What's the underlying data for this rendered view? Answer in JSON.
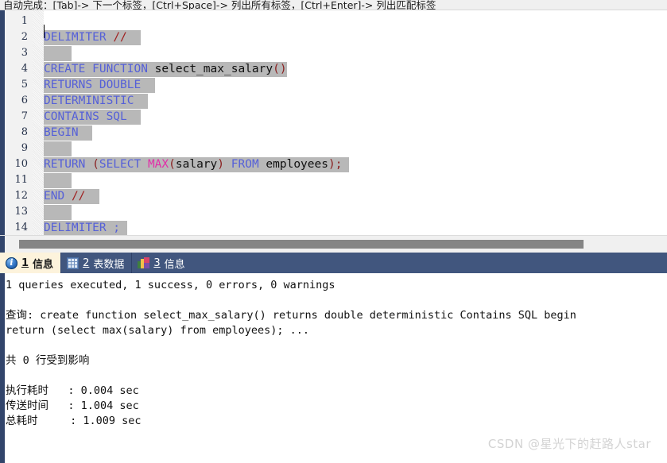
{
  "hint_bar": {
    "text": "自动完成：[Tab]-> 下一个标签，[Ctrl+Space]-> 列出所有标签，[Ctrl+Enter]-> 列出匹配标签"
  },
  "editor": {
    "line_numbers": [
      "1",
      "2",
      "3",
      "4",
      "5",
      "6",
      "7",
      "8",
      "9",
      "10",
      "11",
      "12",
      "13",
      "14"
    ],
    "fold_marker": "collapse-fold-marker",
    "lines": [
      {
        "n": "1",
        "tokens": []
      },
      {
        "n": "2",
        "tokens": [
          {
            "t": "DELIMITER",
            "c": "kw"
          },
          {
            "t": " ",
            "c": "id"
          },
          {
            "t": "//",
            "c": "cm"
          },
          {
            "t": "  ",
            "c": "id"
          }
        ]
      },
      {
        "n": "3",
        "tokens": [
          {
            "t": "    ",
            "c": "id"
          }
        ]
      },
      {
        "n": "4",
        "tokens": [
          {
            "t": "CREATE FUNCTION",
            "c": "kw"
          },
          {
            "t": " select_max_salary",
            "c": "id"
          },
          {
            "t": "()",
            "c": "pn"
          }
        ]
      },
      {
        "n": "5",
        "tokens": [
          {
            "t": "RETURNS DOUBLE",
            "c": "kw"
          },
          {
            "t": "  ",
            "c": "id"
          }
        ]
      },
      {
        "n": "6",
        "tokens": [
          {
            "t": "DETERMINISTIC",
            "c": "kw"
          },
          {
            "t": "  ",
            "c": "id"
          }
        ]
      },
      {
        "n": "7",
        "tokens": [
          {
            "t": "CONTAINS SQL",
            "c": "kw"
          },
          {
            "t": "  ",
            "c": "id"
          }
        ]
      },
      {
        "n": "8",
        "tokens": [
          {
            "t": "BEGIN",
            "c": "kw"
          },
          {
            "t": "  ",
            "c": "id"
          }
        ]
      },
      {
        "n": "9",
        "tokens": [
          {
            "t": "    ",
            "c": "id"
          }
        ]
      },
      {
        "n": "10",
        "tokens": [
          {
            "t": "RETURN ",
            "c": "kw"
          },
          {
            "t": "(",
            "c": "pn"
          },
          {
            "t": "SELECT ",
            "c": "kw"
          },
          {
            "t": "MAX",
            "c": "fn"
          },
          {
            "t": "(",
            "c": "pn"
          },
          {
            "t": "salary",
            "c": "id"
          },
          {
            "t": ")",
            "c": "pn"
          },
          {
            "t": " ",
            "c": "id"
          },
          {
            "t": "FROM",
            "c": "kw"
          },
          {
            "t": " employees",
            "c": "id"
          },
          {
            "t": ");",
            "c": "pn"
          },
          {
            "t": " ",
            "c": "id"
          }
        ]
      },
      {
        "n": "11",
        "tokens": [
          {
            "t": "    ",
            "c": "id"
          }
        ]
      },
      {
        "n": "12",
        "tokens": [
          {
            "t": "END",
            "c": "kw"
          },
          {
            "t": " ",
            "c": "id"
          },
          {
            "t": "//",
            "c": "cm"
          },
          {
            "t": "  ",
            "c": "id"
          }
        ]
      },
      {
        "n": "13",
        "tokens": [
          {
            "t": "    ",
            "c": "id"
          }
        ]
      },
      {
        "n": "14",
        "tokens": [
          {
            "t": "DELIMITER ;",
            "c": "kw"
          },
          {
            "t": " ",
            "c": "id"
          }
        ]
      }
    ],
    "raw_text": "DELIMITER //\n\nCREATE FUNCTION select_max_salary()\nRETURNS DOUBLE\nDETERMINISTIC\nCONTAINS SQL\nBEGIN\n\nRETURN (SELECT MAX(salary) FROM employees);\n\nEND //\n\nDELIMITER ;"
  },
  "tabs": [
    {
      "num": "1",
      "label": "信息",
      "icon": "info-icon",
      "active": true
    },
    {
      "num": "2",
      "label": "表数据",
      "icon": "grid-icon",
      "active": false
    },
    {
      "num": "3",
      "label": "信息",
      "icon": "chart-icon",
      "active": false
    }
  ],
  "results": {
    "lines": [
      "1 queries executed, 1 success, 0 errors, 0 warnings",
      "",
      "查询: create function select_max_salary() returns double deterministic Contains SQL begin",
      "return (select max(salary) from employees); ...",
      "",
      "共 0 行受到影响",
      "",
      "执行耗时   : 0.004 sec",
      "传送时间   : 1.004 sec",
      "总耗时     : 1.009 sec"
    ]
  },
  "watermark": {
    "text": "CSDN @星光下的赶路人star"
  },
  "colors": {
    "rail_navy": "#32456b",
    "tabstrip_navy": "#41567e",
    "active_tab_bg": "#fdf3dc",
    "selection_gray": "#b8b8b8",
    "keyword_blue": "#5560d8",
    "function_pink": "#e12fa8",
    "paren_darkred": "#8a2020",
    "scrollbar_thumb": "#858585"
  }
}
